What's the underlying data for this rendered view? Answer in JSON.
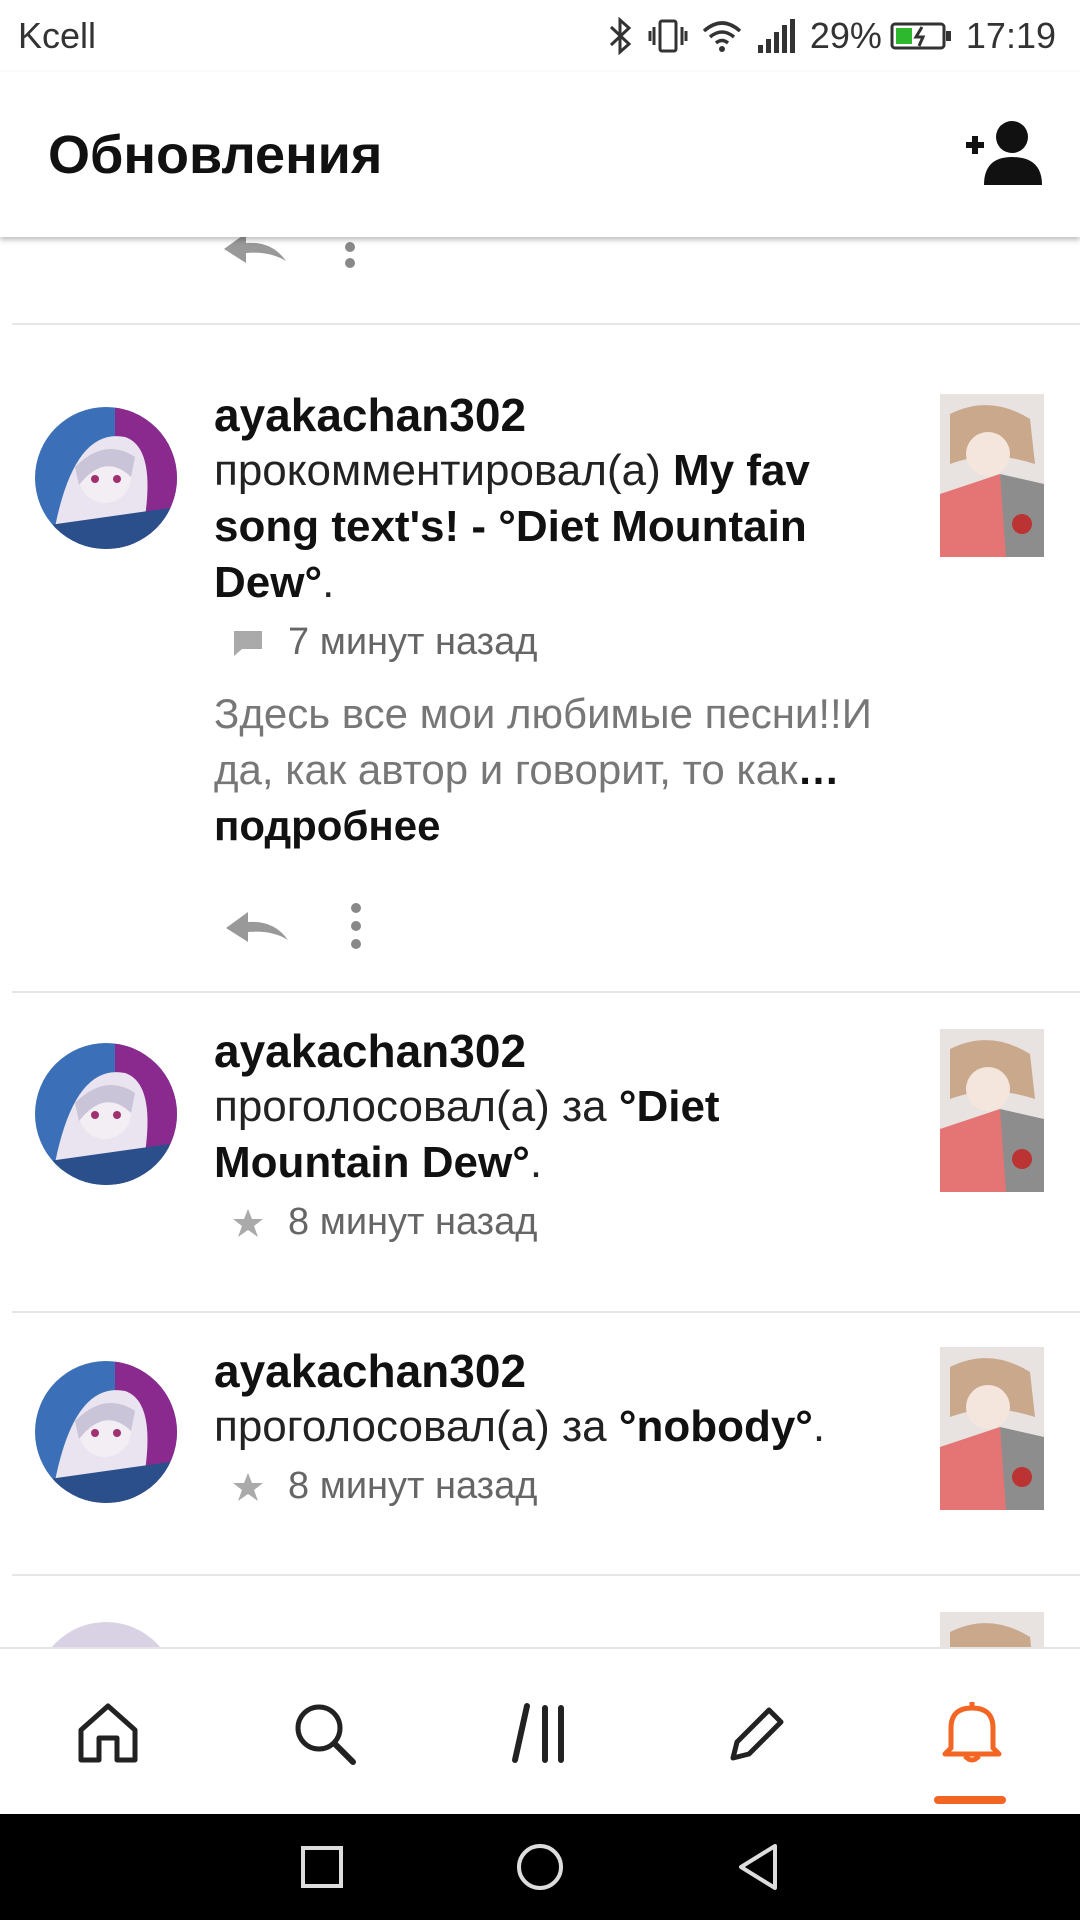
{
  "status_bar": {
    "carrier": "Kcell",
    "battery": "29%",
    "time": "17:19"
  },
  "app_bar": {
    "title": "Обновления",
    "add_user_icon": "add-user-icon"
  },
  "feed": [
    {
      "username": "ayakachan302",
      "action": "прокомментировал(а) ",
      "target_line1": "My fav",
      "target_rest": "song text's! - °Diet Mountain",
      "target_end": "Dew°",
      "period": ".",
      "type_icon": "comment-icon",
      "time": "7 минут назад",
      "snippet": "Здесь все мои любимые песни!!И да, как автор и говорит, то как",
      "more_label": "… подробнее"
    },
    {
      "username": "ayakachan302",
      "action": "проголосовал(а) за ",
      "target_line1": "°Diet",
      "target_rest": "Mountain Dew°",
      "period": ".",
      "type_icon": "star-icon",
      "time": "8 минут назад"
    },
    {
      "username": "ayakachan302",
      "action": "проголосовал(а) за ",
      "target_line1": "°nobody°",
      "period": ".",
      "type_icon": "star-icon",
      "time": "8 минут назад"
    }
  ],
  "bottom_nav": [
    {
      "icon": "home-icon",
      "active": false
    },
    {
      "icon": "search-icon",
      "active": false
    },
    {
      "icon": "library-icon",
      "active": false
    },
    {
      "icon": "pencil-icon",
      "active": false
    },
    {
      "icon": "bell-icon",
      "active": true
    }
  ],
  "colors": {
    "accent": "#f26522",
    "text_primary": "#111111",
    "text_secondary": "#777777"
  }
}
